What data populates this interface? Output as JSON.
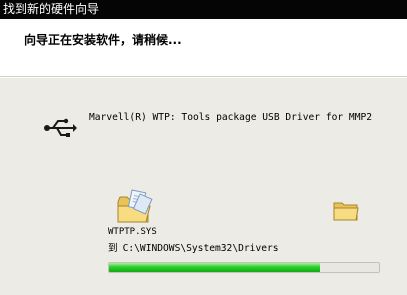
{
  "window": {
    "title": "找到新的硬件向导"
  },
  "header": {
    "status_text": "向导正在安装软件，请稍候..."
  },
  "device": {
    "name": "Marvell(R) WTP: Tools package USB Driver for MMP2",
    "icon": "usb-icon"
  },
  "copy": {
    "file_name": "WTPTP.SYS",
    "dest_label": "到",
    "dest_path": "C:\\WINDOWS\\System32\\Drivers",
    "source_icon": "folder-icon",
    "dest_icon": "folder-icon"
  },
  "progress": {
    "fraction": 0.78,
    "color": "#2bd02b"
  },
  "colors": {
    "titlebar_bg": "#050505",
    "content_bg": "#ecebe5"
  }
}
